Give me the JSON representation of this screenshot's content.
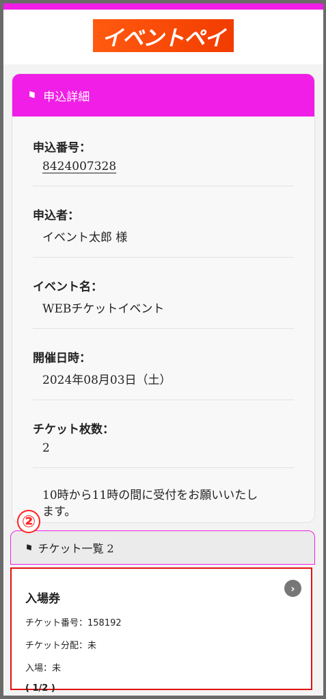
{
  "header": {
    "logo_text": "イベントペイ",
    "accent_color": "#f01ee6"
  },
  "details": {
    "title": "申込詳細",
    "icon": "ticket-tag-icon",
    "fields": [
      {
        "label": "申込番号：",
        "value": "8424007328"
      },
      {
        "label": "申込者：",
        "value": "イベント太郎 様"
      },
      {
        "label": "イベント名：",
        "value": "WEBチケットイベント"
      },
      {
        "label": "開催日時：",
        "value": "2024年08月03日（土）"
      },
      {
        "label": "チケット枚数：",
        "value": "2"
      }
    ],
    "note_line1": "10時から11時の間に受付をお願いいたし",
    "note_line2": "ます。"
  },
  "annotation": {
    "number": "②",
    "color": "#ff2020"
  },
  "ticket_list": {
    "title": "チケット一覧 2",
    "ticket": {
      "name": "入場券",
      "number_line": "チケット番号：158192",
      "distribution_line": "チケット分配：未",
      "entry_line": "入場：未",
      "count": "( 1/2 )",
      "arrow_icon": "chevron-right-icon"
    }
  }
}
